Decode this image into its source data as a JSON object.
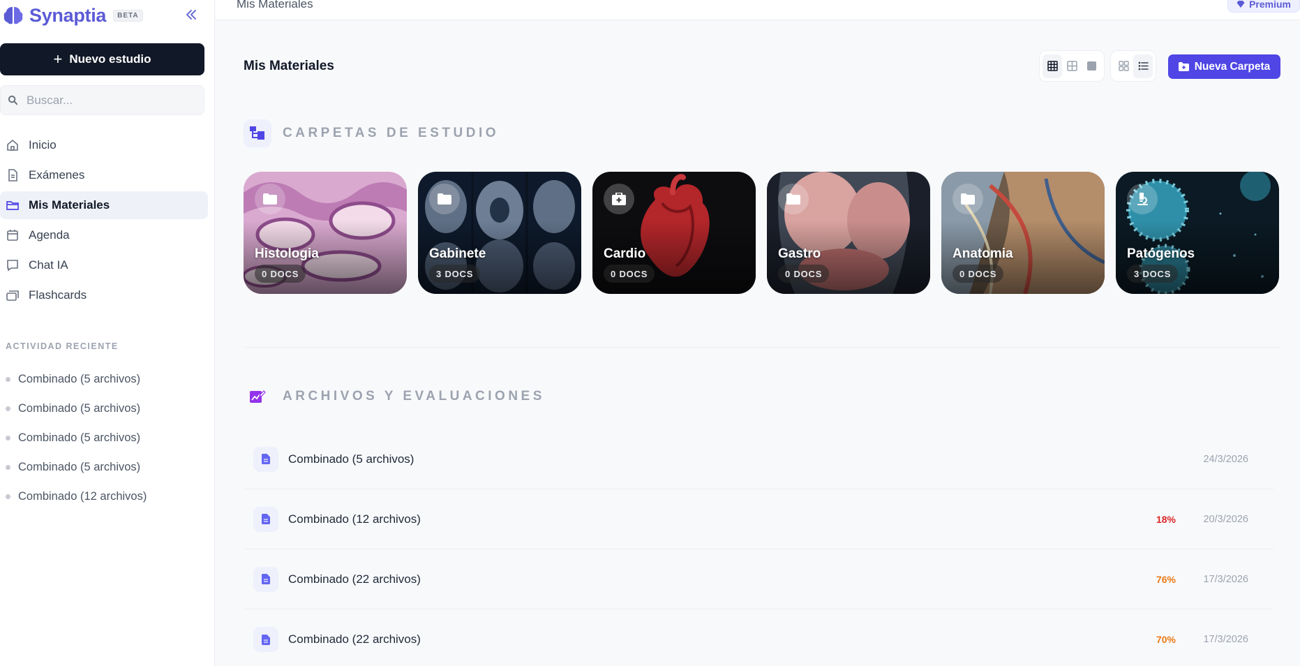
{
  "brand": {
    "name": "Synaptia",
    "beta": "BETA"
  },
  "sidebar": {
    "new_study_label": "Nuevo estudio",
    "search_placeholder": "Buscar...",
    "nav": [
      {
        "label": "Inicio",
        "icon": "home-icon"
      },
      {
        "label": "Exámenes",
        "icon": "document-icon"
      },
      {
        "label": "Mis Materiales",
        "icon": "folder-icon",
        "active": true
      },
      {
        "label": "Agenda",
        "icon": "calendar-icon"
      },
      {
        "label": "Chat IA",
        "icon": "chat-icon"
      },
      {
        "label": "Flashcards",
        "icon": "cards-icon"
      }
    ],
    "recent_title": "ACTIVIDAD RECIENTE",
    "recent": [
      "Combinado (5 archivos)",
      "Combinado (5 archivos)",
      "Combinado (5 archivos)",
      "Combinado (5 archivos)",
      "Combinado (12 archivos)"
    ]
  },
  "topbar": {
    "breadcrumb": "Mis Materiales",
    "premium_label": "Premium"
  },
  "main": {
    "title": "Mis Materiales",
    "new_folder_label": "Nueva Carpeta",
    "folders_title": "CARPETAS DE ESTUDIO",
    "files_title": "ARCHIVOS Y EVALUACIONES"
  },
  "folders": [
    {
      "name": "Histologia",
      "docs": "0 DOCS",
      "icon": "folder-icon"
    },
    {
      "name": "Gabinete",
      "docs": "3 DOCS",
      "icon": "folder-icon"
    },
    {
      "name": "Cardio",
      "docs": "0 DOCS",
      "icon": "medical-kit-icon"
    },
    {
      "name": "Gastro",
      "docs": "0 DOCS",
      "icon": "folder-icon"
    },
    {
      "name": "Anatomia",
      "docs": "0 DOCS",
      "icon": "folder-icon"
    },
    {
      "name": "Patógenos",
      "docs": "3 DOCS",
      "icon": "microscope-icon"
    }
  ],
  "files": [
    {
      "name": "Combinado (5 archivos)",
      "score": "",
      "date": "24/3/2026"
    },
    {
      "name": "Combinado (12 archivos)",
      "score": "18%",
      "date": "20/3/2026",
      "score_color": "#dc2626"
    },
    {
      "name": "Combinado (22 archivos)",
      "score": "76%",
      "date": "17/3/2026",
      "score_color": "#ea7a17"
    },
    {
      "name": "Combinado (22 archivos)",
      "score": "70%",
      "date": "17/3/2026",
      "score_color": "#ea7a17"
    }
  ],
  "colors": {
    "accent": "#4f46e5",
    "brand": "#5b5bd6",
    "dark": "#111827"
  }
}
